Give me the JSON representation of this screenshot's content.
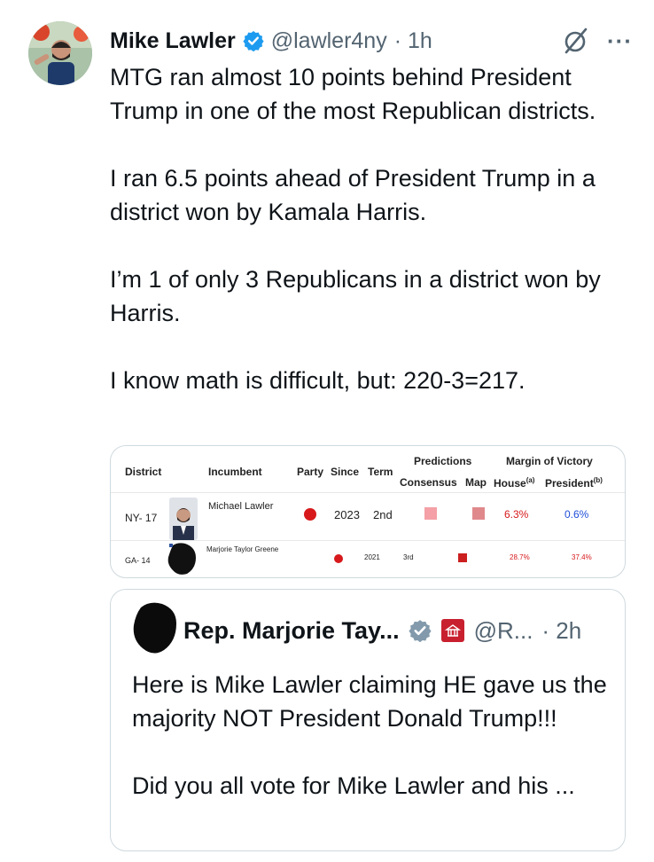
{
  "tweet": {
    "author_name": "Mike Lawler",
    "handle": "@lawler4ny",
    "timestamp": "· 1h",
    "more_label": "···",
    "paragraphs": [
      "MTG ran almost 10 points behind President Trump in one of the most Republican districts.",
      "I ran 6.5 points ahead of President Trump in a district won by Kamala Harris.",
      "I’m 1 of only 3 Republicans in a district won by Harris.",
      "I know math is difficult, but: 220-3=217."
    ],
    "icons": {
      "verified": "verified-badge-icon",
      "grok": "grok-slash-icon",
      "more": "more-options-icon"
    }
  },
  "table": {
    "headers": {
      "district": "District",
      "incumbent": "Incumbent",
      "party": "Party",
      "since": "Since",
      "term": "Term",
      "predictions": "Predictions",
      "margin": "Margin of Victory",
      "consensus": "Consensus",
      "map": "Map",
      "house": "House",
      "house_sup": "(a)",
      "president": "President",
      "president_sup": "(b)"
    },
    "rows": [
      {
        "district": "NY- 17",
        "incumbent": "Michael Lawler",
        "since": "2023",
        "term": "2nd",
        "house": "6.3%",
        "president": "0.6%",
        "party_color": "#d7191c",
        "consensus_color": "#f4a0a6",
        "map_color": "#e0898c",
        "president_color": "#1f4fd8"
      },
      {
        "district": "GA- 14",
        "incumbent": "Marjorie Taylor Greene",
        "since": "2021",
        "term": "3rd",
        "house": "28.7%",
        "president": "37.4%",
        "party_color": "#d7191c",
        "map_color": "#cc1f1f",
        "president_color": "#d7191c"
      }
    ]
  },
  "quoted": {
    "author_name": "Rep. Marjorie Tay...",
    "handle": "@R...",
    "timestamp": "· 2h",
    "paragraphs": [
      "Here is Mike Lawler claiming HE gave us the majority NOT President Donald Trump!!!",
      "Did you all vote for Mike Lawler and his ..."
    ],
    "icons": {
      "verified": "gray-verified-badge-icon",
      "flag": "government-seal-icon"
    }
  },
  "colors": {
    "text": "#0f1419",
    "muted": "#536471",
    "verified_blue": "#1d9bf0",
    "republican_red": "#d7191c",
    "border": "#cfd9de"
  }
}
